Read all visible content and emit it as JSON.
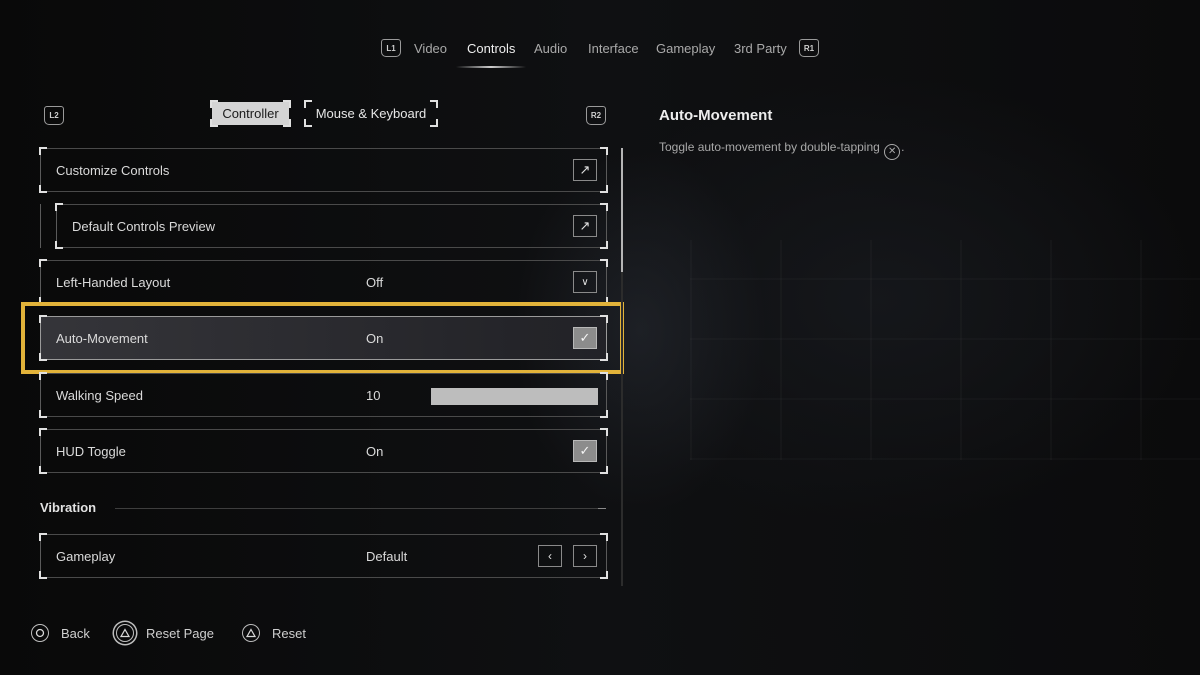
{
  "top_tabs": {
    "left_badge": "L1",
    "right_badge": "R1",
    "items": [
      "Video",
      "Controls",
      "Audio",
      "Interface",
      "Gameplay",
      "3rd Party"
    ],
    "active": "Controls"
  },
  "sub_tabs": {
    "left_badge": "L2",
    "right_badge": "R2",
    "controller": "Controller",
    "mouse_keyboard": "Mouse & Keyboard",
    "active": "Controller"
  },
  "settings": {
    "customize_controls": {
      "label": "Customize Controls",
      "icon": "external-link-icon"
    },
    "default_controls_preview": {
      "label": "Default Controls Preview",
      "icon": "external-link-icon"
    },
    "left_handed_layout": {
      "label": "Left-Handed Layout",
      "value": "Off",
      "icon": "chevron-down-icon"
    },
    "auto_movement": {
      "label": "Auto-Movement",
      "value": "On",
      "checked": true
    },
    "walking_speed": {
      "label": "Walking Speed",
      "value": "10",
      "fill_fraction": 1.0
    },
    "hud_toggle": {
      "label": "HUD Toggle",
      "value": "On",
      "checked": true
    }
  },
  "vibration": {
    "heading": "Vibration",
    "gameplay": {
      "label": "Gameplay",
      "value": "Default"
    }
  },
  "info_panel": {
    "title": "Auto-Movement",
    "desc_before": "Toggle auto-movement by double-tapping",
    "desc_after": ".",
    "button_glyph": "✕"
  },
  "footer": {
    "back": "Back",
    "reset_page": "Reset Page",
    "reset": "Reset"
  },
  "colors": {
    "highlight": "#e2b33a",
    "background": "#0b0b0c"
  }
}
